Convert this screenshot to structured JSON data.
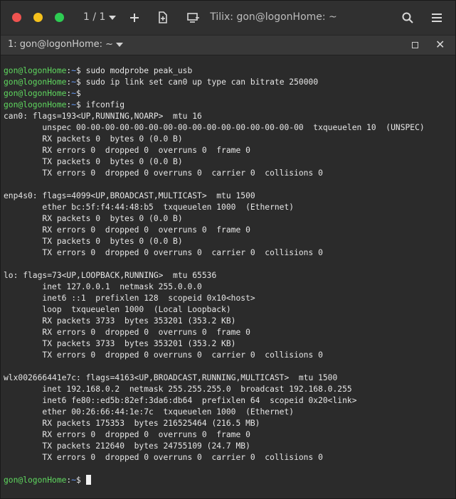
{
  "titlebar": {
    "counter": "1 / 1",
    "title": "Tilix: gon@logonHome: ~",
    "add_icon": "plus-icon",
    "new_session_icon": "new-session-icon",
    "sync_icon": "sync-input-icon",
    "search_icon": "search-icon",
    "menu_icon": "hamburger-menu-icon"
  },
  "tab": {
    "label": "1: gon@logonHome: ~",
    "close": "✕"
  },
  "terminal": {
    "prompt_user": "gon@logonHome",
    "prompt_sep": ":",
    "prompt_path": "~",
    "prompt_end": "$ ",
    "commands": [
      "sudo modprobe peak_usb",
      "sudo ip link set can0 up type can bitrate 250000",
      "",
      "ifconfig"
    ],
    "output": [
      "can0: flags=193<UP,RUNNING,NOARP>  mtu 16",
      "        unspec 00-00-00-00-00-00-00-00-00-00-00-00-00-00-00-00  txqueuelen 10  (UNSPEC)",
      "        RX packets 0  bytes 0 (0.0 B)",
      "        RX errors 0  dropped 0  overruns 0  frame 0",
      "        TX packets 0  bytes 0 (0.0 B)",
      "        TX errors 0  dropped 0 overruns 0  carrier 0  collisions 0",
      "",
      "enp4s0: flags=4099<UP,BROADCAST,MULTICAST>  mtu 1500",
      "        ether bc:5f:f4:44:48:b5  txqueuelen 1000  (Ethernet)",
      "        RX packets 0  bytes 0 (0.0 B)",
      "        RX errors 0  dropped 0  overruns 0  frame 0",
      "        TX packets 0  bytes 0 (0.0 B)",
      "        TX errors 0  dropped 0 overruns 0  carrier 0  collisions 0",
      "",
      "lo: flags=73<UP,LOOPBACK,RUNNING>  mtu 65536",
      "        inet 127.0.0.1  netmask 255.0.0.0",
      "        inet6 ::1  prefixlen 128  scopeid 0x10<host>",
      "        loop  txqueuelen 1000  (Local Loopback)",
      "        RX packets 3733  bytes 353201 (353.2 KB)",
      "        RX errors 0  dropped 0  overruns 0  frame 0",
      "        TX packets 3733  bytes 353201 (353.2 KB)",
      "        TX errors 0  dropped 0 overruns 0  carrier 0  collisions 0",
      "",
      "wlx002666441e7c: flags=4163<UP,BROADCAST,RUNNING,MULTICAST>  mtu 1500",
      "        inet 192.168.0.2  netmask 255.255.255.0  broadcast 192.168.0.255",
      "        inet6 fe80::ed5b:82ef:3da6:db64  prefixlen 64  scopeid 0x20<link>",
      "        ether 00:26:66:44:1e:7c  txqueuelen 1000  (Ethernet)",
      "        RX packets 175353  bytes 216525464 (216.5 MB)",
      "        RX errors 0  dropped 0  overruns 0  frame 0",
      "        TX packets 212640  bytes 24755109 (24.7 MB)",
      "        TX errors 0  dropped 0 overruns 0  carrier 0  collisions 0",
      ""
    ],
    "final_command": ""
  },
  "colors": {
    "prompt_user": "#5fd75f",
    "prompt_path": "#6aa0ff",
    "text": "#e6e6e6",
    "background": "#2b2b2b",
    "close_dot": "#ef5350",
    "minimize_dot": "#f5c11c",
    "maximize_dot": "#2ecc53"
  }
}
